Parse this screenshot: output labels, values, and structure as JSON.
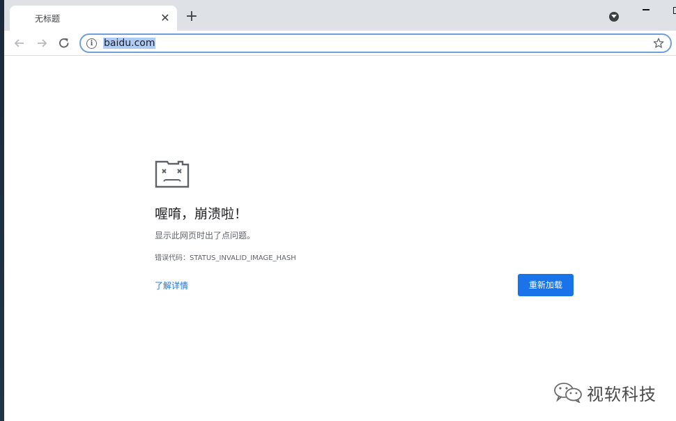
{
  "browser": {
    "tab_title": "无标题",
    "tab_close_glyph": "✕",
    "new_tab_glyph": "+",
    "url": "baidu.com"
  },
  "error_page": {
    "heading": "喔唷，崩溃啦！",
    "description": "显示此网页时出了点问题。",
    "error_code": "错误代码：STATUS_INVALID_IMAGE_HASH",
    "details_link": "了解详情",
    "reload_button": "重新加载"
  },
  "watermark": {
    "text": "视软科技"
  },
  "colors": {
    "accent": "#1a73e8",
    "tabbar": "#dee1e6",
    "omnibox_focus": "#6e9fd8",
    "url_selection": "#adcbf5"
  },
  "icons": [
    "info-icon",
    "star-icon",
    "back-arrow-icon",
    "forward-arrow-icon",
    "reload-icon",
    "sad-tab-icon",
    "wechat-icon"
  ]
}
